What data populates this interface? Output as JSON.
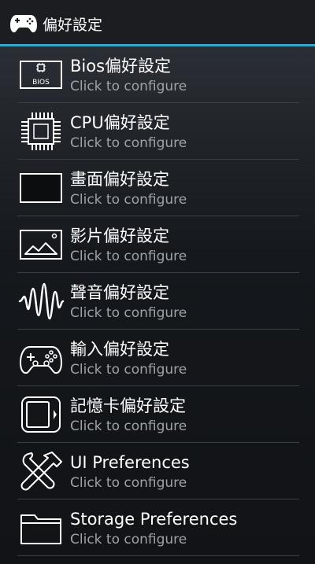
{
  "header": {
    "title": "偏好設定",
    "icon": "gamepad-icon"
  },
  "colors": {
    "accent": "#3aa6c8",
    "subtitle": "#9ea3a8"
  },
  "items": [
    {
      "label": "Bios偏好設定",
      "subtitle": "Click to configure",
      "icon": "bios-chip-icon",
      "icon_text": "BIOS"
    },
    {
      "label": "CPU偏好設定",
      "subtitle": "Click to configure",
      "icon": "cpu-icon"
    },
    {
      "label": "畫面偏好設定",
      "subtitle": "Click to configure",
      "icon": "screen-icon"
    },
    {
      "label": "影片偏好設定",
      "subtitle": "Click to configure",
      "icon": "picture-icon"
    },
    {
      "label": "聲音偏好設定",
      "subtitle": "Click to configure",
      "icon": "waveform-icon"
    },
    {
      "label": "輸入偏好設定",
      "subtitle": "Click to configure",
      "icon": "gamepad-icon"
    },
    {
      "label": "記憶卡偏好設定",
      "subtitle": "Click to configure",
      "icon": "memory-card-icon"
    },
    {
      "label": "UI Preferences",
      "subtitle": "Click to configure",
      "icon": "wrench-hammer-icon"
    },
    {
      "label": "Storage Preferences",
      "subtitle": "Click to configure",
      "icon": "folder-icon"
    }
  ]
}
